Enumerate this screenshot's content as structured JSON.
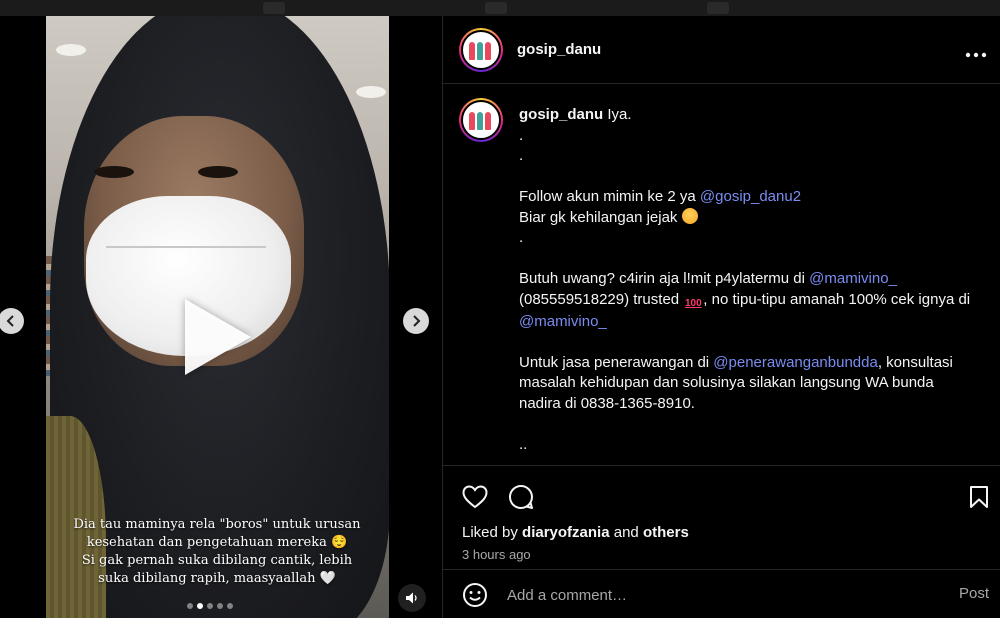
{
  "post": {
    "username": "gosip_danu",
    "more_icon": "more-horizontal-icon"
  },
  "media": {
    "caption_lines": [
      "Dia tau maminya rela \"boros\" untuk urusan",
      "kesehatan dan pengetahuan mereka 😌",
      "Si gak pernah suka dibilang cantik, lebih",
      "suka dibilang rapih, maasyaallah 🤍"
    ],
    "carousel_count": 5,
    "carousel_active_index": 1,
    "prev_icon": "chevron-left-icon",
    "next_icon": "chevron-right-icon",
    "play_icon": "play-icon",
    "audio_icon": "speaker-icon"
  },
  "caption": {
    "username": "gosip_danu",
    "first_line": "Iya.",
    "dot1": ".",
    "dot2": ".",
    "follow_text": "Follow akun mimin ke 2 ya ",
    "follow_mention": "@gosip_danu2",
    "jejak_text": "Biar gk kehilangan jejak ",
    "dot3": ".",
    "butuh_text_1": "Butuh uwang? c4irin aja l!mit p4ylatermu di ",
    "butuh_mention_1": "@mamivino_",
    "butuh_text_2": " (085559518229) trusted ",
    "hundred_emoji": "100",
    "butuh_text_3": ", no tipu-tipu amanah 100% cek ignya di ",
    "butuh_mention_2": "@mamivino_",
    "jasa_text_1": "Untuk jasa penerawangan di ",
    "jasa_mention": "@penerawanganbundda",
    "jasa_text_2": ", konsultasi masalah kehidupan dan solusinya silakan langsung WA bunda nadira di 0838-1365-8910.",
    "dots_end": ".."
  },
  "actions": {
    "like_icon": "heart-icon",
    "comment_icon": "comment-icon",
    "save_icon": "bookmark-icon",
    "liked_by_prefix": "Liked by ",
    "liked_by_user": "diaryofzania",
    "liked_by_and": " and ",
    "liked_by_others": "others",
    "time_ago": "3 hours ago"
  },
  "comment_box": {
    "emoji_icon": "smiley-icon",
    "placeholder": "Add a comment…",
    "post_label": "Post"
  }
}
